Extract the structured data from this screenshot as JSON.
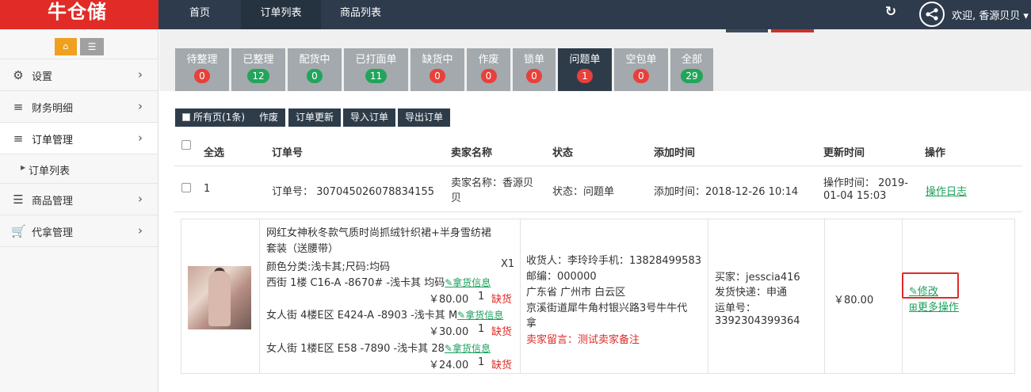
{
  "app": {
    "logo_text": "牛仓储"
  },
  "topnav": {
    "items": [
      "首页",
      "订单列表",
      "商品列表"
    ],
    "active": "订单列表"
  },
  "header": {
    "welcome": "欢迎, 香源贝贝"
  },
  "sidebar": {
    "items": [
      {
        "label": "设置",
        "icon": "gears-icon"
      },
      {
        "label": "财务明细",
        "icon": "bars-icon"
      },
      {
        "label": "订单管理",
        "icon": "bars-icon"
      },
      {
        "label": "商品管理",
        "icon": "list-icon"
      },
      {
        "label": "代拿管理",
        "icon": "cart-icon"
      }
    ],
    "subitem": "订单列表"
  },
  "status_tabs": [
    {
      "label": "待整理",
      "count": "0",
      "color": "#e8403a"
    },
    {
      "label": "已整理",
      "count": "12",
      "color": "#22a55b"
    },
    {
      "label": "配货中",
      "count": "0",
      "color": "#22a55b"
    },
    {
      "label": "已打面单",
      "count": "11",
      "color": "#22a55b"
    },
    {
      "label": "缺货中",
      "count": "0",
      "color": "#e8403a"
    },
    {
      "label": "作废",
      "count": "0",
      "color": "#e8403a"
    },
    {
      "label": "锁单",
      "count": "0",
      "color": "#e8403a"
    },
    {
      "label": "问题单",
      "count": "1",
      "color": "#e8403a",
      "active": true
    },
    {
      "label": "空包单",
      "count": "0",
      "color": "#e8403a"
    },
    {
      "label": "全部",
      "count": "29",
      "color": "#22a55b"
    }
  ],
  "actions": {
    "all_pages": "所有页(1条)",
    "void": "作废",
    "update": "订单更新",
    "import": "导入订单",
    "export": "导出订单"
  },
  "table": {
    "headers": {
      "select_all": "全选",
      "order_no": "订单号",
      "seller": "卖家名称",
      "status": "状态",
      "added": "添加时间",
      "updated": "更新时间",
      "ops": "操作"
    },
    "row": {
      "index": "1",
      "order_no": "订单号： 307045026078834155",
      "seller_line1": "卖家名称：香源贝",
      "seller_line2": "贝",
      "status": "状态：问题单",
      "added": "添加时间：2018-12-26 10:14",
      "updated_line1": "操作时间： 2019-",
      "updated_line2": "01-04 15:03",
      "log_link": "操作日志"
    }
  },
  "detail": {
    "title_line1": "网红女神秋冬款气质时尚抓绒针织裙+半身雪纺裙",
    "title_line2": "套装（送腰带）",
    "spec": "颜色分类:浅卡其;尺码:均码",
    "qty": "X1",
    "sources": [
      {
        "location": "西街 1楼 C16-A -8670# -浅卡其 均码",
        "link": "拿货信息",
        "price": "￥80.00",
        "num": "1",
        "status": "缺货"
      },
      {
        "location": "女人街 4楼E区 E424-A -8903 -浅卡其 M",
        "link": "拿货信息",
        "price": "￥30.00",
        "num": "1",
        "status": "缺货"
      },
      {
        "location": "女人街 1楼E区 E58 -7890 -浅卡其 28",
        "link": "拿货信息",
        "price": "￥24.00",
        "num": "1",
        "status": "缺货"
      }
    ],
    "receiver": "收货人：李玲玲手机：13828499583",
    "postcode": "邮编：000000",
    "addr1": "广东省 广州市 白云区",
    "addr2": "京溪街道犀牛角村银兴路3号牛牛代",
    "addr3": "拿",
    "seller_note": "卖家留言：测试卖家备注",
    "buyer": "买家：jesscia416",
    "express": "发货快递：申通",
    "waybill_label": "运单号：",
    "waybill": "3392304399364",
    "amount": "￥80.00",
    "modify": "修改",
    "more": "更多操作"
  }
}
